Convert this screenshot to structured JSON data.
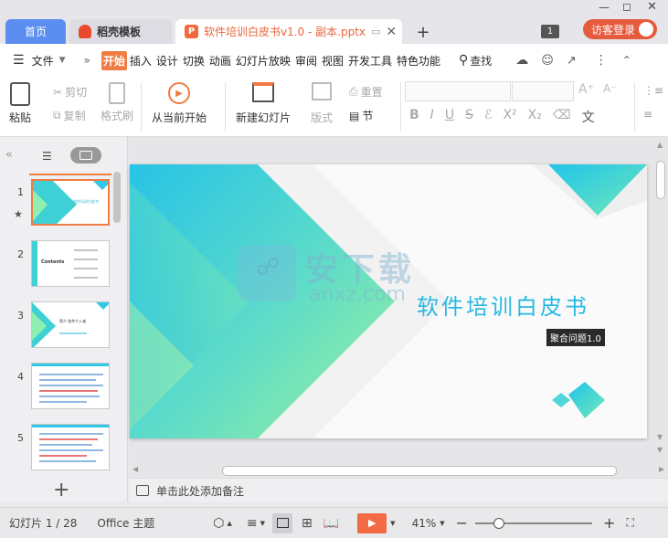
{
  "tabs": {
    "home": "首页",
    "template": "稻壳模板",
    "file": "软件培训白皮书v1.0 - 副本.pptx",
    "new_tab": "+",
    "window_count": "1",
    "login": "访客登录"
  },
  "menu": {
    "file": "文件",
    "items": [
      "开始",
      "插入",
      "设计",
      "切换",
      "动画",
      "幻灯片放映",
      "审阅",
      "视图",
      "开发工具",
      "特色功能"
    ],
    "search": "查找"
  },
  "ribbon": {
    "paste": "粘贴",
    "cut": "剪切",
    "copy": "复制",
    "format_painter": "格式刷",
    "play_from_current": "从当前开始",
    "new_slide": "新建幻灯片",
    "layout": "版式",
    "section": "节",
    "reset": "重置"
  },
  "slides": {
    "numbers": [
      "1",
      "2",
      "3",
      "4",
      "5"
    ],
    "thumb_titles": [
      "软件培训白皮书",
      "Contents",
      "简介 软件介入者",
      "",
      ""
    ]
  },
  "slide": {
    "title": "软件培训白皮书",
    "subtitle": "聚合问题1.0",
    "watermark": "安下载",
    "watermark_domain": "anxz.com"
  },
  "notes": {
    "placeholder": "单击此处添加备注"
  },
  "status": {
    "slide_counter": "幻灯片 1 / 28",
    "theme": "Office 主题",
    "zoom": "41%",
    "zoom_level": 0.41
  },
  "colors": {
    "accent": "#f07c43",
    "tab_blue": "#5b8ef0",
    "slide_cyan": "#27c3e6",
    "slide_green": "#7ee8a2"
  }
}
